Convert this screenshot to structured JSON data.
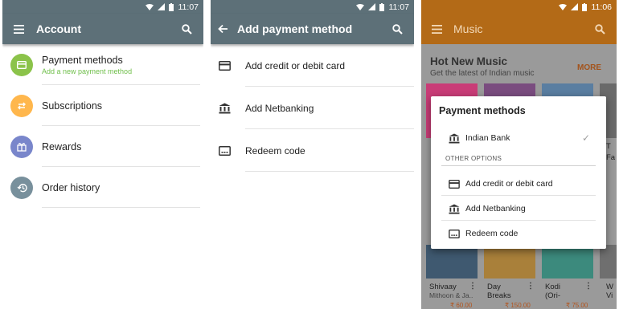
{
  "status": {
    "time_1": "11:07",
    "time_2": "11:07",
    "time_3": "11:06"
  },
  "account": {
    "title": "Account",
    "items": [
      {
        "label": "Payment methods",
        "sub": "Add a new payment method",
        "color": "#8bc34a",
        "icon": "card-icon"
      },
      {
        "label": "Subscriptions",
        "color": "#ffb74d",
        "icon": "refresh-icon"
      },
      {
        "label": "Rewards",
        "color": "#7986cb",
        "icon": "gift-icon"
      },
      {
        "label": "Order history",
        "color": "#78909c",
        "icon": "history-icon"
      }
    ]
  },
  "add_payment": {
    "title": "Add payment method",
    "items": [
      {
        "label": "Add credit or debit card",
        "icon": "card-icon"
      },
      {
        "label": "Add Netbanking",
        "icon": "bank-icon"
      },
      {
        "label": "Redeem code",
        "icon": "redeem-icon"
      }
    ]
  },
  "music": {
    "title": "Music",
    "section_title": "Hot New Music",
    "section_sub": "Get the latest of Indian music",
    "more": "MORE",
    "partial_texts": {
      "t3": "T",
      "t4": "Fa"
    },
    "albums": [
      {
        "title": "Shivaay",
        "sub": "Mithoon & Ja..",
        "price": "₹ 60.00"
      },
      {
        "title": "Day",
        "sub": "Breaks",
        "price": "₹ 150.00"
      },
      {
        "title": "Kodi",
        "sub": "(Ori-",
        "price": "₹ 75.00"
      },
      {
        "title": "W",
        "sub": "Vi",
        "price": ""
      }
    ]
  },
  "dialog": {
    "title": "Payment methods",
    "selected": {
      "label": "Indian Bank",
      "icon": "bank-icon"
    },
    "other_options": "OTHER OPTIONS",
    "options": [
      {
        "label": "Add credit or debit card",
        "icon": "card-icon"
      },
      {
        "label": "Add Netbanking",
        "icon": "bank-icon"
      },
      {
        "label": "Redeem code",
        "icon": "redeem-icon"
      }
    ]
  }
}
